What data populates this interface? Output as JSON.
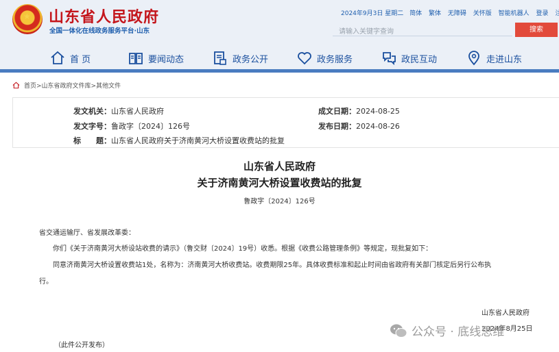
{
  "header": {
    "site_title": "山东省人民政府",
    "site_subtitle": "全国一体化在线政务服务平台·山东",
    "top_links": [
      "2024年9月3日 星期二",
      "简体",
      "繁体",
      "无障碍",
      "关怀版",
      "智能机器人",
      "登录",
      "注"
    ],
    "search_placeholder": "请输入关键字查询",
    "search_button": "搜索",
    "nav": [
      {
        "label": "首 页",
        "icon": "home-icon"
      },
      {
        "label": "要闻动态",
        "icon": "news-book-icon"
      },
      {
        "label": "政务公开",
        "icon": "document-stamp-icon"
      },
      {
        "label": "政务服务",
        "icon": "heart-service-icon"
      },
      {
        "label": "政民互动",
        "icon": "interaction-icon"
      },
      {
        "label": "走进山东",
        "icon": "location-icon"
      }
    ]
  },
  "breadcrumb": "首页>山东省政府文件库>其他文件",
  "meta": {
    "issuer_label": "发文机关：",
    "issuer": "山东省人民政府",
    "doc_no_label": "发文字号：",
    "doc_no": "鲁政字〔2024〕126号",
    "subject_label": "标　　题：",
    "subject": "山东省人民政府关于济南黄河大桥设置收费站的批复",
    "written_label": "成文日期：",
    "written": "2024-08-25",
    "published_label": "发布日期：",
    "published": "2024-08-26"
  },
  "document": {
    "title_line1": "山东省人民政府",
    "title_line2": "关于济南黄河大桥设置收费站的批复",
    "doc_number": "鲁政字〔2024〕126号",
    "addressee": "省交通运输厅、省发展改革委：",
    "para1": "你们《关于济南黄河大桥设站收费的请示》（鲁交财〔2024〕19号）收悉。根据《收费公路管理条例》等规定，现批复如下：",
    "para2_line1": "同意济南黄河大桥设置收费站1处，名称为：济南黄河大桥收费站。收费期限25年。具体收费标准和起止时间由省政府有关部门核定后另行公布执",
    "para2_line2": "行。",
    "signature": "山东省人民政府",
    "sign_date": "2024年8月25日",
    "note": "（此件公开发布）"
  },
  "watermark": "公众号 · 底线思维",
  "colors": {
    "brand_red": "#c4161c",
    "brand_blue": "#1f5fae",
    "nav_bar": "#4a7cc0",
    "search_button": "#e24a3b",
    "header_bg": "#ebf0f7"
  }
}
